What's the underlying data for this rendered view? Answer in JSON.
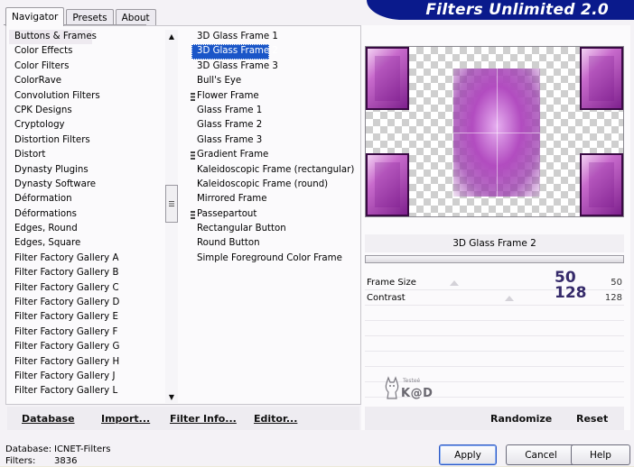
{
  "tabs": [
    {
      "label": "Navigator",
      "active": true
    },
    {
      "label": "Presets",
      "active": false
    },
    {
      "label": "About",
      "active": false
    }
  ],
  "banner_title": "Filters Unlimited 2.0",
  "categories": [
    "Buttons & Frames",
    "Color Effects",
    "Color Filters",
    "ColorRave",
    "Convolution Filters",
    "CPK Designs",
    "Cryptology",
    "Distortion Filters",
    "Distort",
    "Dynasty Plugins",
    "Dynasty Software",
    "Déformation",
    "Déformations",
    "Edges, Round",
    "Edges, Square",
    "Filter Factory Gallery A",
    "Filter Factory Gallery B",
    "Filter Factory Gallery C",
    "Filter Factory Gallery D",
    "Filter Factory Gallery E",
    "Filter Factory Gallery F",
    "Filter Factory Gallery G",
    "Filter Factory Gallery H",
    "Filter Factory Gallery J",
    "Filter Factory Gallery L"
  ],
  "selected_category_index": 0,
  "filters": [
    {
      "label": "3D Glass Frame 1",
      "grip": false
    },
    {
      "label": "3D Glass Frame 2",
      "grip": false,
      "selected": true
    },
    {
      "label": "3D Glass Frame 3",
      "grip": false
    },
    {
      "label": "Bull's Eye",
      "grip": false
    },
    {
      "label": "Flower Frame",
      "grip": true
    },
    {
      "label": "Glass Frame 1",
      "grip": false
    },
    {
      "label": "Glass Frame 2",
      "grip": false
    },
    {
      "label": "Glass Frame 3",
      "grip": false
    },
    {
      "label": "Gradient Frame",
      "grip": true
    },
    {
      "label": "Kaleidoscopic Frame (rectangular)",
      "grip": false
    },
    {
      "label": "Kaleidoscopic Frame (round)",
      "grip": false
    },
    {
      "label": "Mirrored Frame",
      "grip": false
    },
    {
      "label": "Passepartout",
      "grip": true
    },
    {
      "label": "Rectangular Button",
      "grip": false
    },
    {
      "label": "Round Button",
      "grip": false
    },
    {
      "label": "Simple Foreground Color Frame",
      "grip": false
    }
  ],
  "left_links": {
    "database": "Database",
    "import": "Import...",
    "filter_info": "Filter Info...",
    "editor": "Editor..."
  },
  "preview": {
    "filter_name": "3D Glass Frame 2"
  },
  "params": [
    {
      "label": "Frame Size",
      "value": "50",
      "value_small": "50",
      "fraction": 0.196
    },
    {
      "label": "Contrast",
      "value": "128",
      "value_small": "128",
      "fraction": 0.502
    }
  ],
  "watermark": {
    "small": "Testeé",
    "name": "K@D"
  },
  "right_links": {
    "randomize": "Randomize",
    "reset": "Reset"
  },
  "status": {
    "database_label": "Database:",
    "database_value": "ICNET-Filters",
    "filters_label": "Filters:",
    "filters_value": "3836"
  },
  "buttons": {
    "apply": "Apply",
    "cancel": "Cancel",
    "help": "Help"
  },
  "colors": {
    "banner": "#0a1a8c",
    "selection": "#1a56c8",
    "param_value": "#352a6a"
  }
}
